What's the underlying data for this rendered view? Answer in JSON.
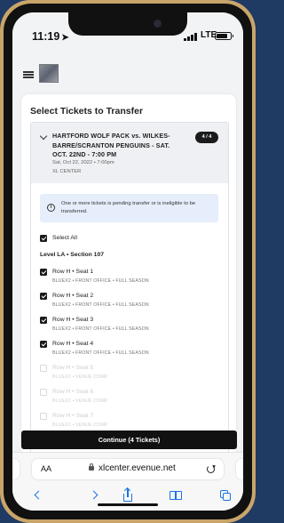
{
  "status_bar": {
    "time": "11:19",
    "network": "LTE"
  },
  "app": {
    "menu_icon": "hamburger-icon",
    "logo": "team-logo"
  },
  "page": {
    "title": "Select Tickets to Transfer"
  },
  "event": {
    "title": "HARTFORD WOLF PACK vs. WILKES-BARRE/SCRANTON PENGUINS - SAT. OCT. 22ND - 7:00 PM",
    "date": "Sat, Oct 22, 2022 • 7:00pm",
    "venue": "XL CENTER",
    "count_badge": "4 / 4"
  },
  "notice": {
    "text": "One or more tickets is pending transfer or is ineligible to be transferred."
  },
  "select_all_label": "Select All",
  "section_label": "Level LA • Section 107",
  "seats": [
    {
      "name": "Row H • Seat 1",
      "desc": "BLUEX2 • FRONT OFFICE • FULL SEASON",
      "checked": true
    },
    {
      "name": "Row H • Seat 2",
      "desc": "BLUEX2 • FRONT OFFICE • FULL SEASON",
      "checked": true
    },
    {
      "name": "Row H • Seat 3",
      "desc": "BLUEX2 • FRONT OFFICE • FULL SEASON",
      "checked": true
    },
    {
      "name": "Row H • Seat 4",
      "desc": "BLUEX2 • FRONT OFFICE • FULL SEASON",
      "checked": true
    },
    {
      "name": "Row H • Seat 5",
      "desc": "BLUEX2 • VENUE COMP",
      "checked": false
    },
    {
      "name": "Row H • Seat 6",
      "desc": "BLUEX2 • VENUE COMP",
      "checked": false
    },
    {
      "name": "Row H • Seat 7",
      "desc": "BLUEX2 • VENUE COMP",
      "checked": false
    }
  ],
  "continue_label": "Continue (4 Tickets)",
  "browser": {
    "aa_label": "AA",
    "url": "xlcenter.evenue.net"
  },
  "colors": {
    "primary": "#111111",
    "notice_bg": "#e5eefa",
    "safari_blue": "#1a73e8",
    "frame_gold": "#c9a56a",
    "background": "#1f3a63"
  }
}
